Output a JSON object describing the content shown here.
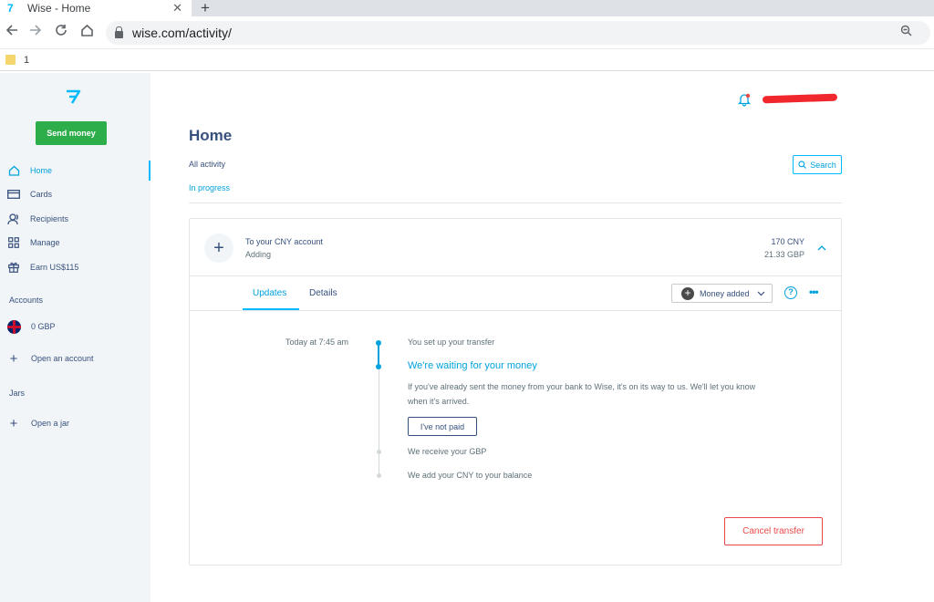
{
  "browser": {
    "tab_title": "Wise - Home",
    "tab_close": "✕",
    "new_tab": "+",
    "url": "wise.com/activity/",
    "bookmark_label": "1",
    "icons": [
      "back-icon",
      "forward-icon",
      "reload-icon",
      "home-icon",
      "lock-icon",
      "zoom-icon"
    ]
  },
  "sidebar": {
    "logo": "7",
    "send_money": "Send money",
    "nav": [
      {
        "label": "Home",
        "icon": "home-icon",
        "active": true
      },
      {
        "label": "Cards",
        "icon": "card-icon",
        "active": false
      },
      {
        "label": "Recipients",
        "icon": "recipients-icon",
        "active": false
      },
      {
        "label": "Manage",
        "icon": "grid-icon",
        "active": false
      },
      {
        "label": "Earn US$115",
        "icon": "gift-icon",
        "active": false
      }
    ],
    "accounts_heading": "Accounts",
    "account_balance": "0 GBP",
    "open_account": "Open an account",
    "jars_heading": "Jars",
    "open_jar": "Open a jar",
    "plus": "+"
  },
  "main": {
    "title": "Home",
    "filter_all": "All activity",
    "filter_in_progress": "In progress",
    "search_label": "Search",
    "transfer": {
      "icon": "+",
      "title": "To your CNY account",
      "status": "Adding",
      "amount": "170 CNY",
      "amount_source": "21.33 GBP",
      "chevron": "^"
    },
    "tabs": {
      "updates": "Updates",
      "details": "Details"
    },
    "status_select": {
      "icon": "+",
      "label": "Money added"
    },
    "help": "?",
    "more": "•••",
    "timeline": {
      "time": "Today at 7:45 am",
      "step1": "You set up your transfer",
      "current_title": "We're waiting for your money",
      "current_desc": "If you've already sent the money from your bank to Wise, it's on its way to us. We'll let you know when it's arrived.",
      "not_paid": "I've not paid",
      "step3": "We receive your GBP",
      "step4": "We add your CNY to your balance"
    },
    "cancel": "Cancel transfer"
  },
  "colors": {
    "accent": "#00b9ff",
    "link": "#00a2dd",
    "navy": "#37517e",
    "green": "#2ead4b",
    "danger": "#e74848",
    "sidebar_bg": "#f2f5f7"
  }
}
